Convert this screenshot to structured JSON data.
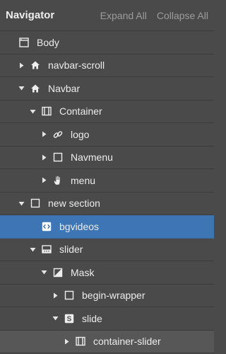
{
  "header": {
    "title": "Navigator",
    "expand_all": "Expand All",
    "collapse_all": "Collapse All"
  },
  "tree": [
    {
      "label": "Body",
      "icon": "page-icon",
      "caret": "none",
      "depth": 0
    },
    {
      "label": "navbar-scroll",
      "icon": "home-icon",
      "caret": "collapsed",
      "depth": 1
    },
    {
      "label": "Navbar",
      "icon": "home-icon",
      "caret": "expanded",
      "depth": 1
    },
    {
      "label": "Container",
      "icon": "container-icon",
      "caret": "expanded",
      "depth": 2
    },
    {
      "label": "logo",
      "icon": "link-icon",
      "caret": "collapsed",
      "depth": 3
    },
    {
      "label": "Navmenu",
      "icon": "square-icon",
      "caret": "collapsed",
      "depth": 3
    },
    {
      "label": "menu",
      "icon": "hand-icon",
      "caret": "collapsed",
      "depth": 3
    },
    {
      "label": "new section",
      "icon": "square-icon",
      "caret": "expanded",
      "depth": 1
    },
    {
      "label": "bgvideos",
      "icon": "code-embed-icon",
      "caret": "none",
      "depth": 2,
      "selected": true
    },
    {
      "label": "slider",
      "icon": "slider-icon",
      "caret": "expanded",
      "depth": 2
    },
    {
      "label": "Mask",
      "icon": "mask-icon",
      "caret": "expanded",
      "depth": 3
    },
    {
      "label": "begin-wrapper",
      "icon": "square-icon",
      "caret": "collapsed",
      "depth": 4
    },
    {
      "label": "slide",
      "icon": "slide-icon",
      "caret": "expanded",
      "depth": 4
    },
    {
      "label": "container-slider",
      "icon": "container-icon",
      "caret": "collapsed",
      "depth": 5
    }
  ]
}
